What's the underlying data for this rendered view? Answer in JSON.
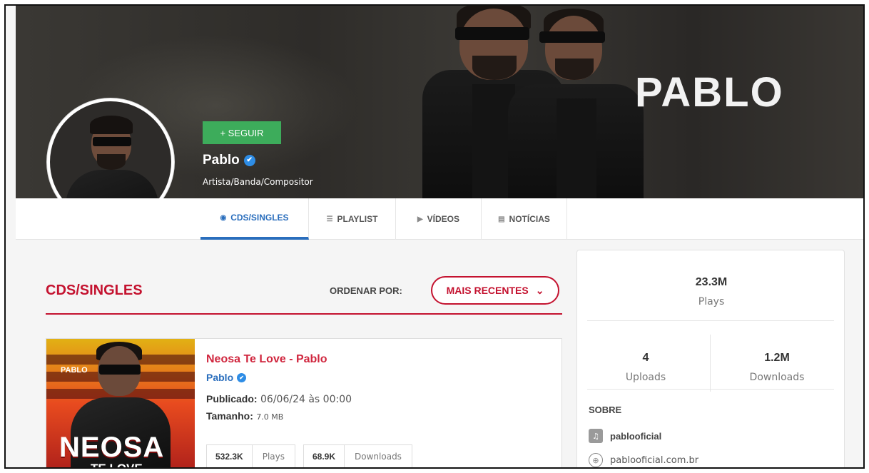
{
  "banner": {
    "brand_text": "PABLO"
  },
  "profile": {
    "follow_label": "+ SEGUIR",
    "name": "Pablo",
    "role": "Artista/Banda/Compositor",
    "verified_glyph": "✔"
  },
  "tabs": [
    {
      "label": "CDS/SINGLES",
      "icon": "disc-icon",
      "glyph": "◉",
      "active": true
    },
    {
      "label": "PLAYLIST",
      "icon": "list-icon",
      "glyph": "☰",
      "active": false
    },
    {
      "label": "VÍDEOS",
      "icon": "play-icon",
      "glyph": "▶",
      "active": false
    },
    {
      "label": "NOTÍCIAS",
      "icon": "news-icon",
      "glyph": "▤",
      "active": false
    }
  ],
  "main": {
    "section_title": "CDS/SINGLES",
    "order_label": "ORDENAR POR:",
    "order_value": "MAIS RECENTES",
    "order_chevron": "⌄"
  },
  "track": {
    "cover_logo": "PABLO",
    "cover_title_line1": "NEOSA",
    "cover_title_line2": "TE LOVE",
    "title": "Neosa Te Love - Pablo",
    "artist": "Pablo",
    "published_label": "Publicado:",
    "published_value": "06/06/24 às 00:00",
    "size_label": "Tamanho:",
    "size_value": "7.0 MB",
    "plays_num": "532.3K",
    "plays_label": "Plays",
    "downloads_num": "68.9K",
    "downloads_label": "Downloads"
  },
  "sidebar": {
    "plays_num": "23.3M",
    "plays_label": "Plays",
    "uploads_num": "4",
    "uploads_label": "Uploads",
    "downloads_num": "1.2M",
    "downloads_label": "Downloads",
    "about_label": "SOBRE",
    "social_handle": "pablooficial",
    "website": "pablooficial.com.br"
  },
  "colors": {
    "accent_red": "#c4122f",
    "accent_blue": "#2a6ebd",
    "follow_green": "#3dac5b"
  }
}
